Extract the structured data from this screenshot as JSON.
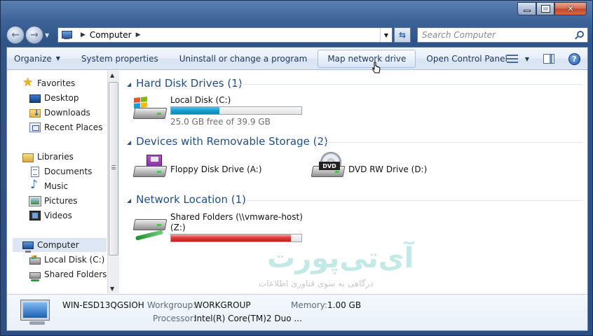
{
  "window": {
    "minimize_label": "",
    "maximize_label": "",
    "close_label": "✕"
  },
  "address": {
    "crumbs": [
      "Computer"
    ]
  },
  "search": {
    "placeholder": "Search Computer"
  },
  "toolbar": {
    "organize": "Organize",
    "system_properties": "System properties",
    "uninstall": "Uninstall or change a program",
    "map_drive": "Map network drive",
    "control_panel": "Open Control Panel"
  },
  "sidebar": {
    "favorites": "Favorites",
    "desktop": "Desktop",
    "downloads": "Downloads",
    "recent": "Recent Places",
    "libraries": "Libraries",
    "documents": "Documents",
    "music": "Music",
    "pictures": "Pictures",
    "videos": "Videos",
    "computer": "Computer",
    "local_disk": "Local Disk (C:)",
    "shared": "Shared Folders (\\"
  },
  "groups": {
    "hdd": "Hard Disk Drives (1)",
    "removable": "Devices with Removable Storage (2)",
    "network": "Network Location (1)"
  },
  "drives": {
    "c_name": "Local Disk (C:)",
    "c_free": "25.0 GB free of 39.9 GB",
    "c_used_fraction": 0.373,
    "floppy": "Floppy Disk Drive (A:)",
    "dvd": "DVD RW Drive (D:)",
    "dvd_badge": "DVD",
    "shared_name": "Shared Folders (\\\\vmware-host)",
    "shared_letter": "(Z:)",
    "shared_used_fraction": 0.92
  },
  "watermark": {
    "logo": "آی‌تی‌پورت",
    "tagline": "درگاهی به سوی فناوری اطلاعات"
  },
  "details": {
    "computer_name": "WIN-ESD13QGSIOH",
    "workgroup_label": "Workgroup:",
    "workgroup_value": "WORKGROUP",
    "memory_label": "Memory:",
    "memory_value": "1.00 GB",
    "processor_label": "Processor:",
    "processor_value": "Intel(R) Core(TM)2 Duo ..."
  },
  "colors": {
    "accent": "#1e4e8c",
    "bar_blue": "#1b9ccd",
    "bar_red": "#e03b3b"
  }
}
